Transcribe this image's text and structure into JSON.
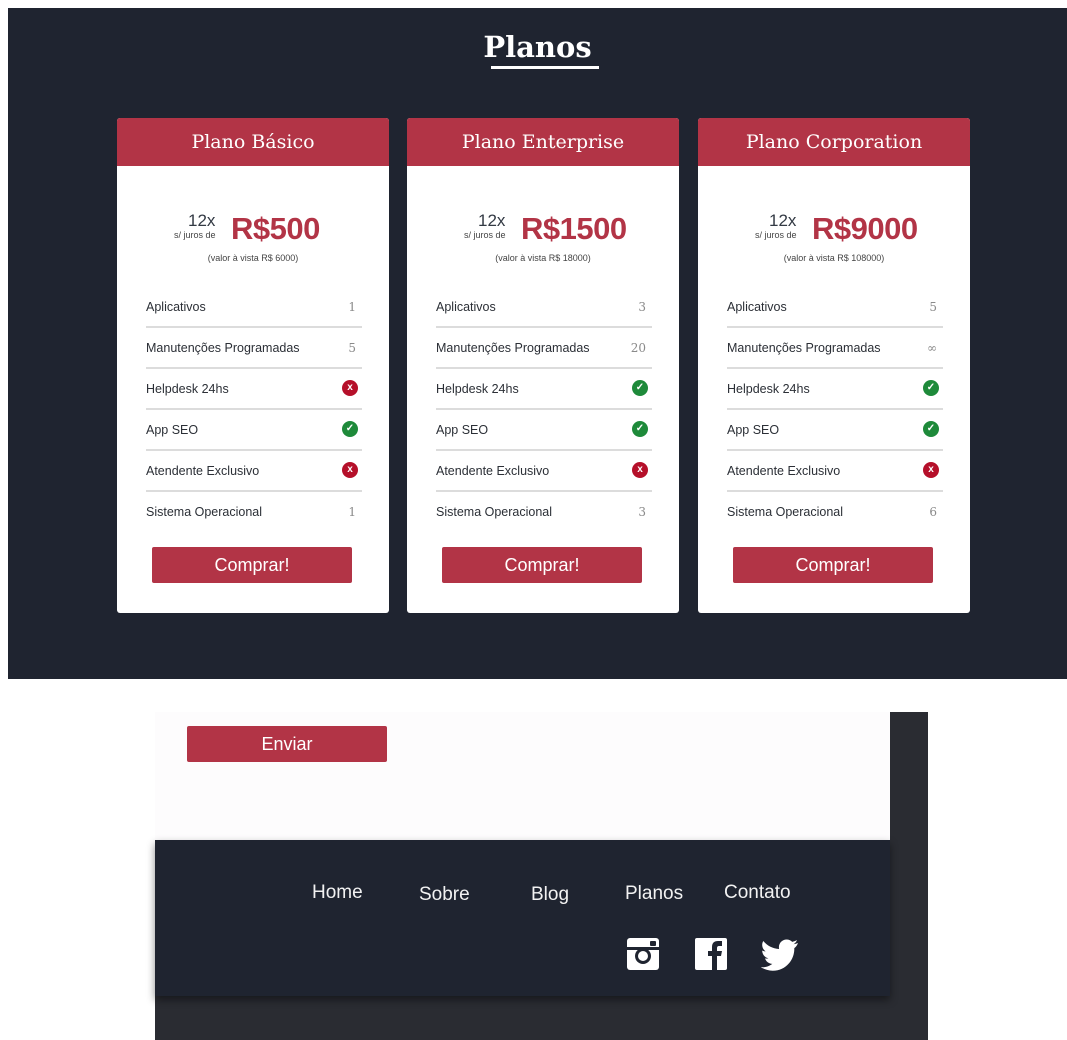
{
  "section_title": "Planos",
  "plans": [
    {
      "name": "Plano Básico",
      "installments": "12x",
      "interest": "s/ juros de",
      "price": "R$500",
      "cash_price": "(valor à vista R$ 6000)",
      "features": [
        {
          "label": "Aplicativos",
          "value": "1"
        },
        {
          "label": "Manutenções Programadas",
          "value": "5"
        },
        {
          "label": "Helpdesk 24hs",
          "icon": "x-icon"
        },
        {
          "label": "App SEO",
          "icon": "check-icon"
        },
        {
          "label": "Atendente Exclusivo",
          "icon": "x-icon"
        },
        {
          "label": "Sistema Operacional",
          "value": "1"
        }
      ],
      "button": "Comprar!"
    },
    {
      "name": "Plano Enterprise",
      "installments": "12x",
      "interest": "s/ juros de",
      "price": "R$1500",
      "cash_price": "(valor à vista R$ 18000)",
      "features": [
        {
          "label": "Aplicativos",
          "value": "3"
        },
        {
          "label": "Manutenções Programadas",
          "value": "20"
        },
        {
          "label": "Helpdesk 24hs",
          "icon": "check-icon"
        },
        {
          "label": "App SEO",
          "icon": "check-icon"
        },
        {
          "label": "Atendente Exclusivo",
          "icon": "x-icon"
        },
        {
          "label": "Sistema Operacional",
          "value": "3"
        }
      ],
      "button": "Comprar!"
    },
    {
      "name": "Plano Corporation",
      "installments": "12x",
      "interest": "s/ juros de",
      "price": "R$9000",
      "cash_price": "(valor à vista R$ 108000)",
      "features": [
        {
          "label": "Aplicativos",
          "value": "5"
        },
        {
          "label": "Manutenções Programadas",
          "value": "∞"
        },
        {
          "label": "Helpdesk 24hs",
          "icon": "check-icon"
        },
        {
          "label": "App SEO",
          "icon": "check-icon"
        },
        {
          "label": "Atendente Exclusivo",
          "icon": "x-icon"
        },
        {
          "label": "Sistema Operacional",
          "value": "6"
        }
      ],
      "button": "Comprar!"
    }
  ],
  "form": {
    "submit_label": "Enviar"
  },
  "footer": {
    "nav": [
      "Home",
      "Sobre",
      "Blog",
      "Planos",
      "Contato"
    ],
    "social": [
      "instagram-icon",
      "facebook-icon",
      "twitter-icon"
    ]
  },
  "colors": {
    "accent": "#b23446",
    "dark_background": "#1f2430",
    "check": "#1e8a3a",
    "cross": "#b5102a"
  }
}
